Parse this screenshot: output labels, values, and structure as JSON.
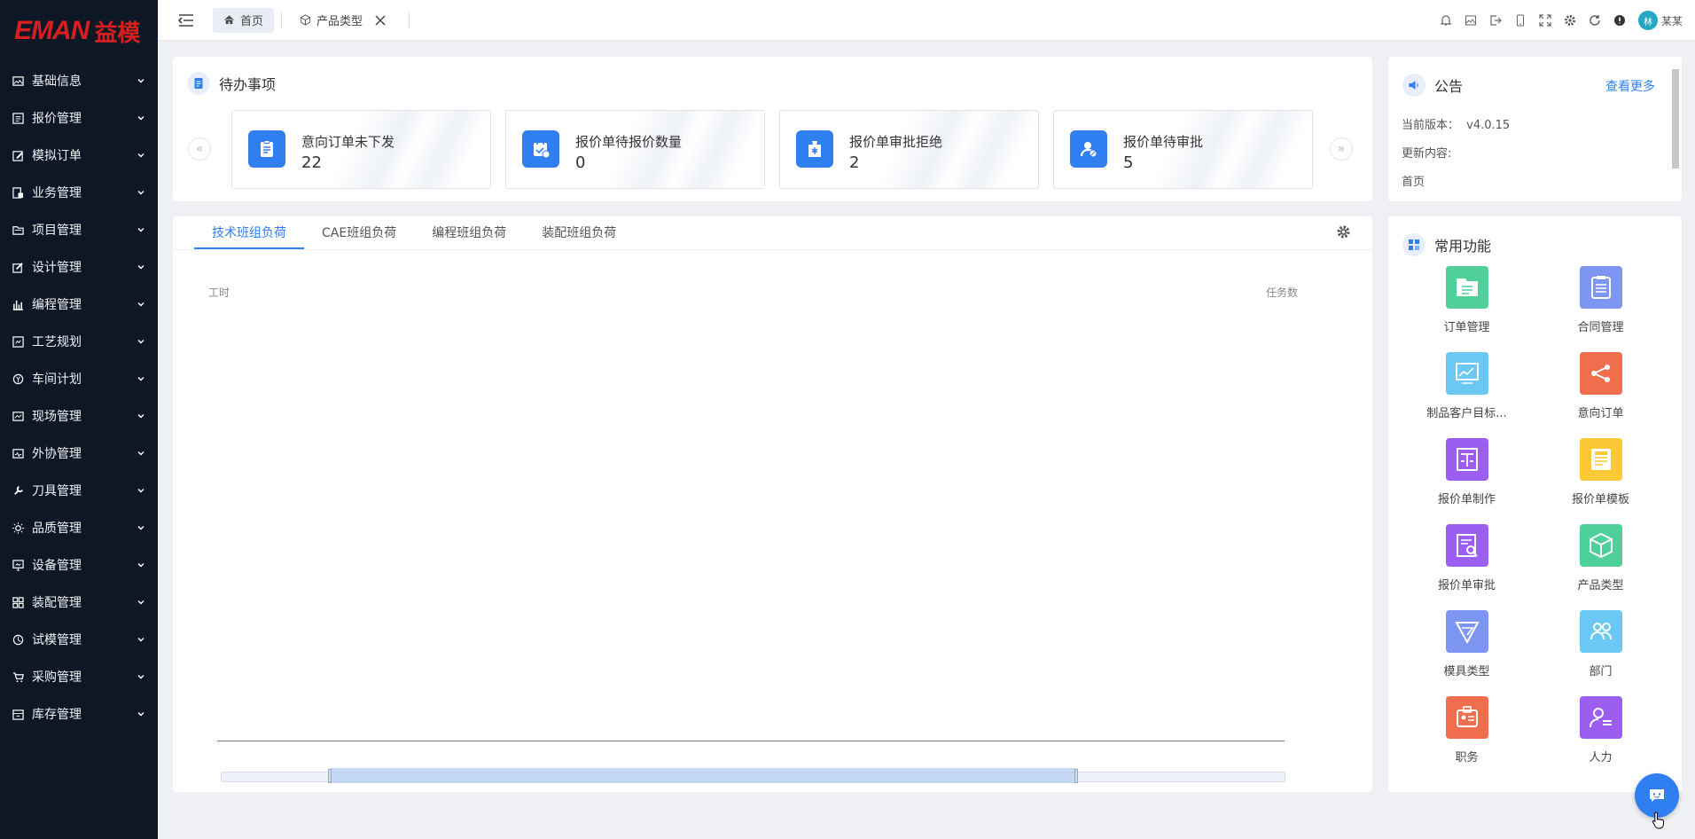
{
  "brand": {
    "en": "EMAN",
    "cn": "益模",
    "color": "#d81e1e"
  },
  "sidebar": {
    "items": [
      {
        "label": "基础信息",
        "icon": "image-icon"
      },
      {
        "label": "报价管理",
        "icon": "list-icon"
      },
      {
        "label": "模拟订单",
        "icon": "edit-icon"
      },
      {
        "label": "业务管理",
        "icon": "lock-doc-icon"
      },
      {
        "label": "项目管理",
        "icon": "folder-icon"
      },
      {
        "label": "设计管理",
        "icon": "pen-icon"
      },
      {
        "label": "编程管理",
        "icon": "bar-chart-icon"
      },
      {
        "label": "工艺规划",
        "icon": "flow-icon"
      },
      {
        "label": "车间计划",
        "icon": "target-icon"
      },
      {
        "label": "现场管理",
        "icon": "monitor-chart-icon"
      },
      {
        "label": "外协管理",
        "icon": "speed-icon"
      },
      {
        "label": "刀具管理",
        "icon": "tool-icon"
      },
      {
        "label": "品质管理",
        "icon": "sun-icon"
      },
      {
        "label": "设备管理",
        "icon": "screen-icon"
      },
      {
        "label": "装配管理",
        "icon": "grid-icon"
      },
      {
        "label": "试模管理",
        "icon": "clock-icon"
      },
      {
        "label": "采购管理",
        "icon": "cart-icon"
      },
      {
        "label": "库存管理",
        "icon": "box-icon"
      }
    ]
  },
  "topbar": {
    "tabs": [
      {
        "label": "首页",
        "icon": "home-icon",
        "active": true
      },
      {
        "label": "产品类型",
        "icon": "cube-icon",
        "active": false
      }
    ],
    "icons": [
      "bell-icon",
      "image-icon",
      "logout-icon",
      "mobile-icon",
      "fullscreen-icon",
      "settings-icon",
      "refresh-icon",
      "alert-icon"
    ],
    "user": {
      "name": "某某",
      "avatar": "林"
    }
  },
  "todo": {
    "title": "待办事项",
    "items": [
      {
        "label": "意向订单未下发",
        "value": "22"
      },
      {
        "label": "报价单待报价数量",
        "value": "0"
      },
      {
        "label": "报价单审批拒绝",
        "value": "2"
      },
      {
        "label": "报价单待审批",
        "value": "5"
      }
    ]
  },
  "notice": {
    "title": "公告",
    "more": "查看更多",
    "version_label": "当前版本：",
    "version": "v4.0.15",
    "update_label": "更新内容:",
    "update_content": "首页"
  },
  "load": {
    "tabs": [
      "技术班组负荷",
      "CAE班组负荷",
      "编程班组负荷",
      "装配班组负荷"
    ],
    "active_tab": 0,
    "axis_left": "工时",
    "axis_right": "任务数"
  },
  "funcs": {
    "title": "常用功能",
    "items": [
      {
        "label": "订单管理",
        "color": "#4fcf9a",
        "icon": "folder-list-icon"
      },
      {
        "label": "合同管理",
        "color": "#7d96f3",
        "icon": "clipboard-icon"
      },
      {
        "label": "制品客户目标...",
        "color": "#6bc7f3",
        "icon": "chart-screen-icon"
      },
      {
        "label": "意向订单",
        "color": "#f06e4e",
        "icon": "share-icon"
      },
      {
        "label": "报价单制作",
        "color": "#9b5ef0",
        "icon": "text-doc-icon"
      },
      {
        "label": "报价单模板",
        "color": "#fbc935",
        "icon": "template-icon"
      },
      {
        "label": "报价单审批",
        "color": "#9b5ef0",
        "icon": "doc-search-icon"
      },
      {
        "label": "产品类型",
        "color": "#4fcf9a",
        "icon": "cube-icon"
      },
      {
        "label": "模具类型",
        "color": "#7d96f3",
        "icon": "send-icon"
      },
      {
        "label": "部门",
        "color": "#6bc7f3",
        "icon": "users-icon"
      },
      {
        "label": "职务",
        "color": "#f06e4e",
        "icon": "badge-icon"
      },
      {
        "label": "人力",
        "color": "#9b5ef0",
        "icon": "person-list-icon"
      }
    ]
  },
  "accent": "#2f7ff0"
}
